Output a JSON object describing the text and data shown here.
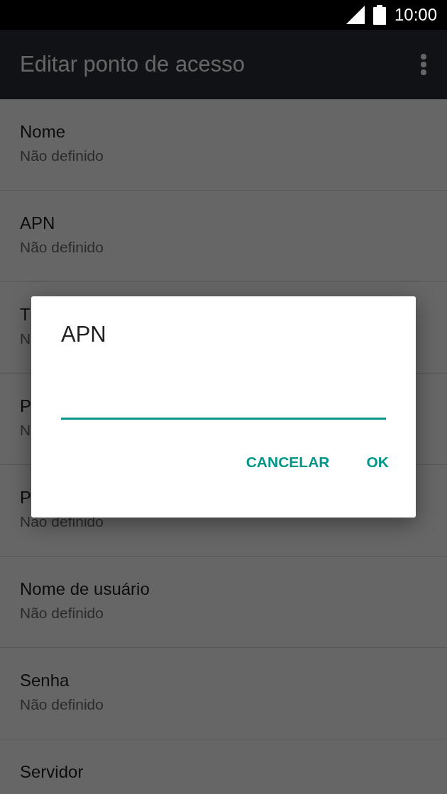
{
  "status_bar": {
    "time": "10:00"
  },
  "toolbar": {
    "title": "Editar ponto de acesso"
  },
  "settings": [
    {
      "title": "Nome",
      "value": "Não definido"
    },
    {
      "title": "APN",
      "value": "Não definido"
    },
    {
      "title": "T",
      "value": "N"
    },
    {
      "title": "P",
      "value": "N"
    },
    {
      "title": "P",
      "value": "Não definido"
    },
    {
      "title": "Nome de usuário",
      "value": "Não definido"
    },
    {
      "title": "Senha",
      "value": "Não definido"
    },
    {
      "title": "Servidor"
    }
  ],
  "dialog": {
    "title": "APN",
    "buttons": [
      "CANCELAR",
      "OK"
    ]
  }
}
